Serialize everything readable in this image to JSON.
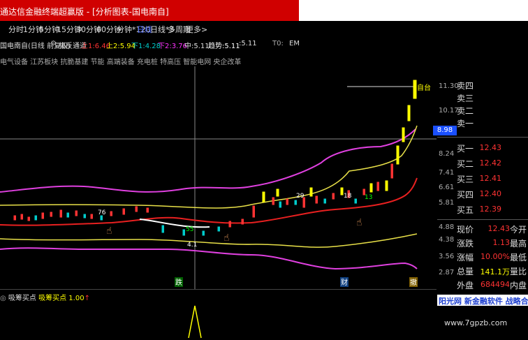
{
  "window": {
    "title": "通达信金融终端超赢版 - [分析图表-国电南自]"
  },
  "toolbar": {
    "items": [
      "分时",
      "1分钟",
      "5分钟",
      "15分钟",
      "30分钟",
      "60分钟",
      "分钟*120",
      "日线",
      "日线*3",
      "多周期",
      "更多"
    ],
    "selected": "日线"
  },
  "info": {
    "stock": "国电南自(日线 前复权)",
    "indicator": "极反通道",
    "up1": "上1:6.46",
    "up2": "上2:5.94",
    "down1": "下1:4.28",
    "down2": "下2:3.76",
    "mid": "中:5.11",
    "trend": "趋势:5.11",
    "last": ":5.11",
    "t0": "T0:",
    "ema": "EM"
  },
  "concepts": "电气设备 江苏板块 抗脆基建 节能 高端装备 充电桩 特高压 智能电网 央企改革",
  "axis": {
    "ticks": [
      "11.30",
      "10.17",
      "8.98",
      "8.24",
      "7.41",
      "6.61",
      "5.81",
      "4.88",
      "4.38",
      "3.56",
      "2.87"
    ],
    "current": "8.98"
  },
  "chart_labels": {
    "high_mark": "自台",
    "mark_76": "76",
    "mark_55": "55",
    "mark_29": "29",
    "mark_18": "18",
    "mark_13": "13",
    "mark_low": "4.1",
    "tag1": "跌",
    "tag2": "财",
    "tag3": "撤"
  },
  "order_book": {
    "asks": [
      {
        "label": "卖四"
      },
      {
        "label": "卖三"
      },
      {
        "label": "卖二"
      },
      {
        "label": "卖一"
      }
    ],
    "bids": [
      {
        "label": "买一",
        "price": "12.43"
      },
      {
        "label": "买二",
        "price": "12.42"
      },
      {
        "label": "买三",
        "price": "12.41"
      },
      {
        "label": "买四",
        "price": "12.40"
      },
      {
        "label": "买五",
        "price": "12.39"
      }
    ]
  },
  "quote": [
    {
      "label": "现价",
      "value": "12.43",
      "suffix": "今开",
      "color": "#ff3333"
    },
    {
      "label": "涨跌",
      "value": "1.13",
      "suffix": "最高",
      "color": "#ff3333"
    },
    {
      "label": "涨幅",
      "value": "10.00%",
      "suffix": "最低",
      "color": "#ff3333"
    },
    {
      "label": "总量",
      "value": "141.1万",
      "suffix": "量比",
      "color": "#ffff00"
    },
    {
      "label": "外盘",
      "value": "684494",
      "suffix": "内盘",
      "color": "#ff3333"
    }
  ],
  "sub_indicator": {
    "name": "吸筹买点",
    "label": "吸筹买点",
    "value": "1.00"
  },
  "promo": "阳光网 新金融软件 战略合作",
  "watermark": "www.7gpzb.com",
  "colors": {
    "title_bg": "#d00000",
    "up": "#ff3333",
    "down": "#00cccc",
    "accent": "#1a4fff"
  }
}
